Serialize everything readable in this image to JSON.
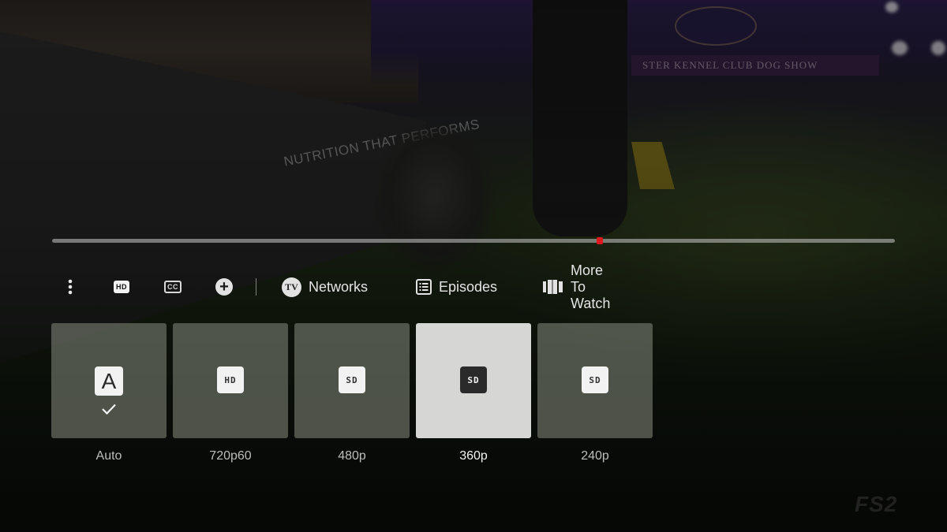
{
  "video": {
    "background_signage": {
      "arena_banner": "STER KENNEL CLUB DOG SHOW",
      "wall_sign": "NUTRITION THAT PERFORMS"
    },
    "channel_watermark": "FS2"
  },
  "playback": {
    "progress_fraction": 0.65,
    "colors": {
      "track": "#c8c8c8",
      "playhead": "#e0161e"
    }
  },
  "controls": {
    "more_options_icon": "kebab-vertical-icon",
    "quality_icon_label": "HD",
    "captions_icon_label": "CC",
    "add_icon": "plus-circle-icon",
    "nav": [
      {
        "label": "Networks",
        "icon": "tv-icon",
        "icon_text": "TV"
      },
      {
        "label": "Episodes",
        "icon": "list-icon"
      },
      {
        "label": "More To Watch",
        "icon": "columns-icon"
      }
    ]
  },
  "quality_menu": {
    "options": [
      {
        "label": "Auto",
        "badge": "A",
        "selected": true,
        "focused": false
      },
      {
        "label": "720p60",
        "badge": "HD",
        "selected": false,
        "focused": false
      },
      {
        "label": "480p",
        "badge": "SD",
        "selected": false,
        "focused": false
      },
      {
        "label": "360p",
        "badge": "SD",
        "selected": false,
        "focused": true
      },
      {
        "label": "240p",
        "badge": "SD",
        "selected": false,
        "focused": false
      }
    ],
    "colors": {
      "tile": "#7d8276",
      "tile_focused": "#d6d6d4",
      "label": "#bdbdbd",
      "label_focused": "#f2f2f2"
    }
  }
}
